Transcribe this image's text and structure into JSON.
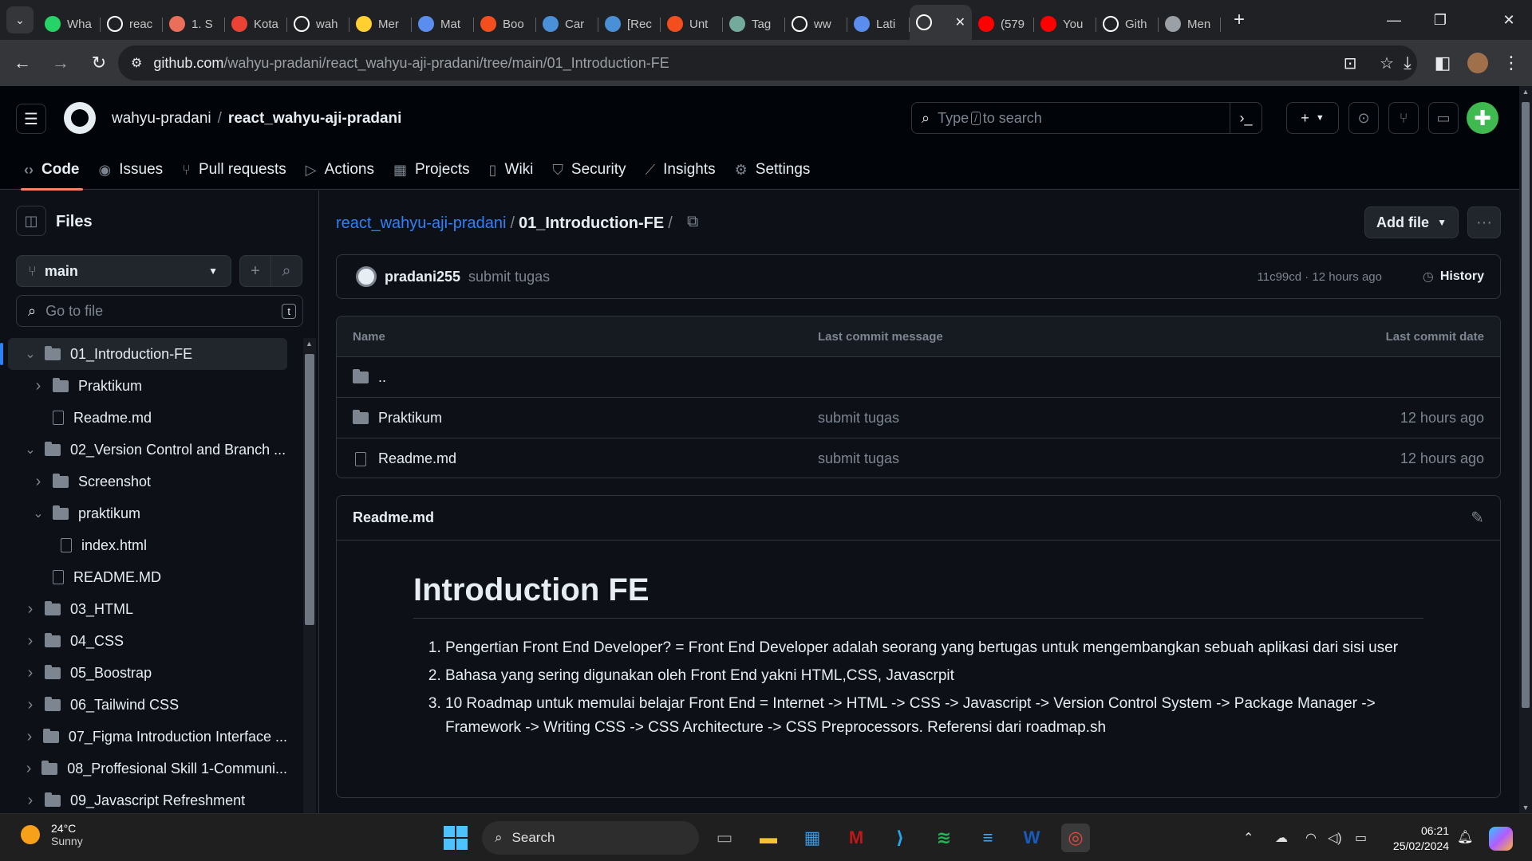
{
  "browser": {
    "tabs": [
      {
        "label": "Wha",
        "icon": "whatsapp-icon",
        "color": "#25d366"
      },
      {
        "label": "reac",
        "icon": "github-icon",
        "color": "#ffffff"
      },
      {
        "label": "1. S",
        "icon": "slides-icon",
        "color": "#e96f5a"
      },
      {
        "label": "Kota",
        "icon": "gmail-icon",
        "color": "#ea4335"
      },
      {
        "label": "wah",
        "icon": "github-icon",
        "color": "#ffffff"
      },
      {
        "label": "Mer",
        "icon": "miro-icon",
        "color": "#ffd02f"
      },
      {
        "label": "Mat",
        "icon": "link-icon",
        "color": "#5b8def"
      },
      {
        "label": "Boo",
        "icon": "figma-icon",
        "color": "#f24e1e"
      },
      {
        "label": "Car",
        "icon": "laptop-icon",
        "color": "#4a90d9"
      },
      {
        "label": "[Rec",
        "icon": "laptop-icon",
        "color": "#4a90d9"
      },
      {
        "label": "Unt",
        "icon": "figma-icon",
        "color": "#f24e1e"
      },
      {
        "label": "Tag",
        "icon": "chatgpt-icon",
        "color": "#74aa9c"
      },
      {
        "label": "ww",
        "icon": "google-icon",
        "color": "#ffffff"
      },
      {
        "label": "Lati",
        "icon": "link-icon",
        "color": "#5b8def"
      },
      {
        "label": "",
        "icon": "github-icon",
        "color": "#ffffff",
        "active": true
      },
      {
        "label": "(579",
        "icon": "youtube-icon",
        "color": "#ff0000"
      },
      {
        "label": "You",
        "icon": "youtube-icon",
        "color": "#ff0000"
      },
      {
        "label": "Gith",
        "icon": "github-icon",
        "color": "#ffffff"
      },
      {
        "label": "Men",
        "icon": "globe-icon",
        "color": "#9aa0a6"
      }
    ],
    "url_host": "github.com",
    "url_path": "/wahyu-pradani/react_wahyu-aji-pradani/tree/main/01_Introduction-FE"
  },
  "header": {
    "owner": "wahyu-pradani",
    "repo": "react_wahyu-aji-pradani",
    "search_prefix": "Type",
    "search_key": "/",
    "search_suffix": "to search"
  },
  "repo_nav": [
    {
      "label": "Code",
      "icon": "code-icon",
      "glyph": "‹›",
      "active": true
    },
    {
      "label": "Issues",
      "icon": "issue-icon",
      "glyph": "◉"
    },
    {
      "label": "Pull requests",
      "icon": "pull-request-icon",
      "glyph": "⑂"
    },
    {
      "label": "Actions",
      "icon": "play-icon",
      "glyph": "▷"
    },
    {
      "label": "Projects",
      "icon": "table-icon",
      "glyph": "▦"
    },
    {
      "label": "Wiki",
      "icon": "book-icon",
      "glyph": "▯"
    },
    {
      "label": "Security",
      "icon": "shield-icon",
      "glyph": "⛉"
    },
    {
      "label": "Insights",
      "icon": "graph-icon",
      "glyph": "⟋"
    },
    {
      "label": "Settings",
      "icon": "gear-icon",
      "glyph": "⚙"
    }
  ],
  "sidebar": {
    "title": "Files",
    "branch": "main",
    "go_to_file": "Go to file",
    "go_to_file_key": "t",
    "tree": [
      {
        "label": "01_Introduction-FE",
        "type": "folder",
        "depth": 0,
        "open": true,
        "selected": true
      },
      {
        "label": "Praktikum",
        "type": "folder",
        "depth": 1,
        "open": false
      },
      {
        "label": "Readme.md",
        "type": "file",
        "depth": 1
      },
      {
        "label": "02_Version Control and Branch ...",
        "type": "folder",
        "depth": 0,
        "open": true
      },
      {
        "label": "Screenshot",
        "type": "folder",
        "depth": 1,
        "open": false
      },
      {
        "label": "praktikum",
        "type": "folder",
        "depth": 1,
        "open": true
      },
      {
        "label": "index.html",
        "type": "file",
        "depth": 2
      },
      {
        "label": "README.MD",
        "type": "file",
        "depth": 1
      },
      {
        "label": "03_HTML",
        "type": "folder",
        "depth": 0,
        "open": false
      },
      {
        "label": "04_CSS",
        "type": "folder",
        "depth": 0,
        "open": false
      },
      {
        "label": "05_Boostrap",
        "type": "folder",
        "depth": 0,
        "open": false
      },
      {
        "label": "06_Tailwind CSS",
        "type": "folder",
        "depth": 0,
        "open": false
      },
      {
        "label": "07_Figma Introduction Interface ...",
        "type": "folder",
        "depth": 0,
        "open": false
      },
      {
        "label": "08_Proffesional Skill 1-Communi...",
        "type": "folder",
        "depth": 0,
        "open": false
      },
      {
        "label": "09_Javascript Refreshment",
        "type": "folder",
        "depth": 0,
        "open": false
      }
    ]
  },
  "main": {
    "path_repo": "react_wahyu-aji-pradani",
    "path_folder": "01_Introduction-FE",
    "add_file": "Add file",
    "commit": {
      "author": "pradani255",
      "message": "submit tugas",
      "meta": "11c99cd · 12 hours ago",
      "history": "History"
    },
    "table": {
      "headers": {
        "name": "Name",
        "message": "Last commit message",
        "date": "Last commit date"
      },
      "parent": "..",
      "rows": [
        {
          "name": "Praktikum",
          "type": "folder",
          "message": "submit tugas",
          "date": "12 hours ago"
        },
        {
          "name": "Readme.md",
          "type": "file",
          "message": "submit tugas",
          "date": "12 hours ago"
        }
      ]
    },
    "readme": {
      "filename": "Readme.md",
      "heading": "Introduction FE",
      "items": [
        "Pengertian Front End Developer? = Front End Developer adalah seorang yang bertugas untuk mengembangkan sebuah aplikasi dari sisi user",
        "Bahasa yang sering digunakan oleh Front End yakni HTML,CSS, Javascrpit",
        "10 Roadmap untuk memulai belajar Front End = Internet -> HTML -> CSS -> Javascript -> Version Control System -> Package Manager -> Framework -> Writing CSS -> CSS Architecture -> CSS Preprocessors. Referensi dari roadmap.sh"
      ]
    }
  },
  "taskbar": {
    "temp": "24°C",
    "weather": "Sunny",
    "search": "Search",
    "time": "06:21",
    "date": "25/02/2024",
    "apps": [
      {
        "icon": "task-view-icon",
        "glyph": "▭",
        "color": "#9a9a9a"
      },
      {
        "icon": "file-explorer-icon",
        "glyph": "▬",
        "color": "#f4c430"
      },
      {
        "icon": "microsoft-store-icon",
        "glyph": "▦",
        "color": "#3a96dd"
      },
      {
        "icon": "mcafee-icon",
        "glyph": "M",
        "color": "#c01818"
      },
      {
        "icon": "vscode-icon",
        "glyph": "⟩",
        "color": "#23a9f2"
      },
      {
        "icon": "spotify-icon",
        "glyph": "≋",
        "color": "#1db954"
      },
      {
        "icon": "notepad-icon",
        "glyph": "≡",
        "color": "#4fa3e0"
      },
      {
        "icon": "word-icon",
        "glyph": "W",
        "color": "#185abd"
      },
      {
        "icon": "chrome-icon",
        "glyph": "◎",
        "color": "#e8453c",
        "active": true
      }
    ]
  }
}
